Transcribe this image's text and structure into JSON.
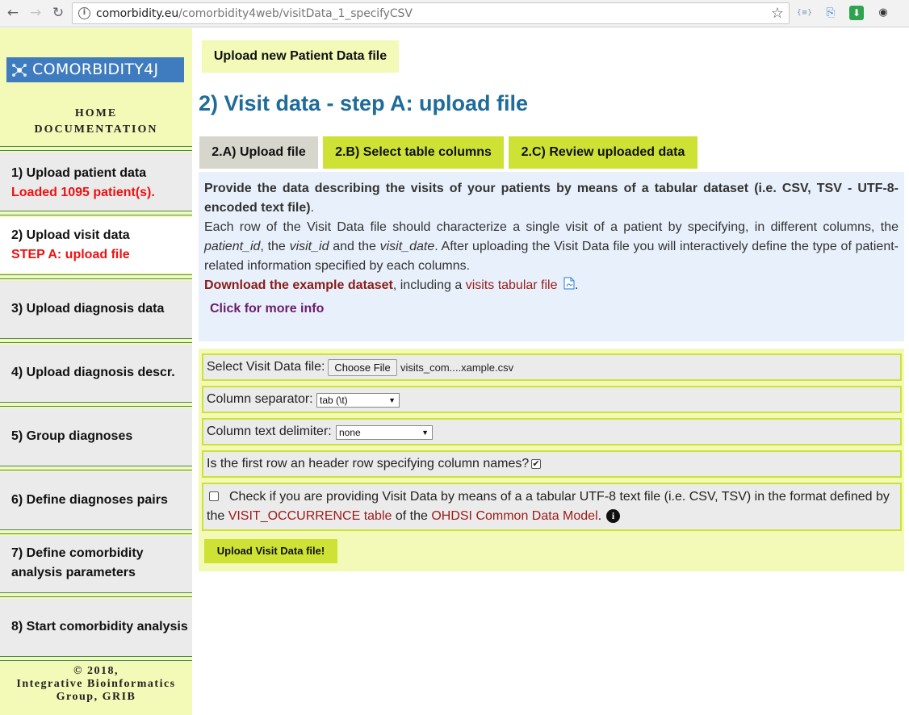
{
  "browser": {
    "url_host": "comorbidity.eu",
    "url_path": "/comorbidity4web/visitData_1_specifyCSV",
    "back_icon": "←",
    "forward_icon": "→",
    "reload_icon": "↻",
    "star_icon": "☆",
    "extensions": [
      {
        "name": "json-ext-icon",
        "glyph": "{≡}",
        "color": "#7a8fb5"
      },
      {
        "name": "doc-ext-icon",
        "glyph": "⎘",
        "color": "#4a8fe0"
      },
      {
        "name": "download-ext-icon",
        "glyph": "⬇",
        "color": "#2ea44f"
      },
      {
        "name": "bulb-ext-icon",
        "glyph": "◉",
        "color": "#333"
      }
    ]
  },
  "sidebar": {
    "logo_text": "COMORBIDITY4J",
    "links": [
      "HOME",
      "DOCUMENTATION"
    ],
    "items": [
      {
        "label": "1) Upload patient data",
        "sub": "Loaded 1095 patient(s)."
      },
      {
        "label": "2) Upload visit data",
        "sub": "STEP A: upload file"
      },
      {
        "label": "3) Upload diagnosis data",
        "sub": ""
      },
      {
        "label": "4) Upload diagnosis descr.",
        "sub": ""
      },
      {
        "label": "5) Group diagnoses",
        "sub": ""
      },
      {
        "label": "6) Define diagnoses pairs",
        "sub": ""
      },
      {
        "label": "7) Define comorbidity",
        "sub": ""
      },
      {
        "label": "8) Start comorbidity analysis",
        "sub": ""
      }
    ],
    "item7_line2": "analysis parameters",
    "footer": [
      "© 2018,",
      "Integrative Bioinformatics",
      "Group, GRIB"
    ]
  },
  "main": {
    "upload_new_button": "Upload new Patient Data file",
    "title": "2) Visit data - step A: upload file",
    "tabs": [
      "2.A) Upload file",
      "2.B) Select table columns",
      "2.C) Review uploaded data"
    ],
    "info": {
      "line1": "Provide the data describing the visits of your patients by means of a tabular dataset (i.e. CSV, TSV - UTF-8-encoded text file)",
      "line1_end": ".",
      "line2_a": "Each row of the Visit Data file should characterize a single visit of a patient by specifying, in different columns, the ",
      "patient_id": "patient_id",
      "comma1": ", the ",
      "visit_id": "visit_id",
      "and_the": " and the ",
      "visit_date": "visit_date",
      "line2_b": ". After uploading the Visit Data file you will interactively define the type of patient-related information specified by each columns.",
      "download_link": "Download the example dataset",
      "including": ", including a ",
      "visits_link": "visits tabular file",
      "period": "."
    },
    "more_info": "Click for more info",
    "form": {
      "file_label": "Select Visit Data file:",
      "choose_file": "Choose File",
      "file_name": "visits_com....xample.csv",
      "separator_label": "Column separator:",
      "separator_value": "tab (\\t)",
      "delimiter_label": "Column text delimiter:",
      "delimiter_value": "none",
      "header_label": "Is the first row an header row specifying column names?",
      "header_checked": true,
      "omop_text_a": "Check if you are providing Visit Data by means of a a tabular UTF-8 text file (i.e. CSV, TSV) in the format defined by",
      "omop_text_b": "the ",
      "omop_link1": "VISIT_OCCURRENCE table",
      "omop_text_c": " of the ",
      "omop_link2": "OHDSI Common Data Model",
      "omop_text_d": ".",
      "omop_checked": false,
      "submit": "Upload Visit Data file!"
    }
  }
}
